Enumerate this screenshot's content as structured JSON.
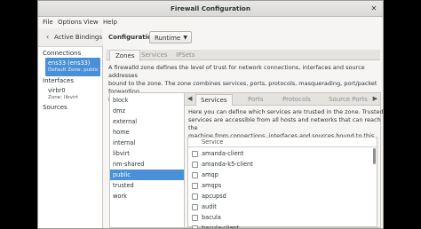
{
  "window": {
    "title": "Firewall Configuration"
  },
  "menubar": [
    "File",
    "Options",
    "View",
    "Help"
  ],
  "bindings": {
    "label": "Active Bindings"
  },
  "configuration": {
    "label": "Configuration:",
    "value": "Runtime"
  },
  "left_panel": {
    "connections_header": "Connections",
    "connection": {
      "name": "ens33 (ens33)",
      "zone": "Default Zone: public"
    },
    "interfaces_header": "Interfaces",
    "interface": {
      "name": "virbr0",
      "zone": "Zone: libvirt"
    },
    "sources_header": "Sources"
  },
  "tabs": [
    {
      "label": "Zones",
      "active": true
    },
    {
      "label": "Services",
      "active": false
    },
    {
      "label": "IPSets",
      "active": false
    }
  ],
  "zones_description": "A firewalld zone defines the level of trust for network connections, interfaces and source addresses\nbound to the zone. The zone combines services, ports, protocols, masquerading, port/packet forwarding,\nicmp filters and rich rules. The zone can be bound to interfaces and source addresses.",
  "zones": [
    "block",
    "dmz",
    "external",
    "home",
    "internal",
    "libvirt",
    "nm-shared",
    "public",
    "trusted",
    "work"
  ],
  "selected_zone": "public",
  "zone_tabs": [
    {
      "label": "Services",
      "active": true
    },
    {
      "label": "Ports",
      "active": false
    },
    {
      "label": "Protocols",
      "active": false
    },
    {
      "label": "Source Ports",
      "active": false
    }
  ],
  "services_description": "Here you can define which services are trusted in the zone. Trusted\nservices are accessible from all hosts and networks that can reach the\nmachine from connections, interfaces and sources bound to this zone.",
  "services_table": {
    "header": "Service",
    "rows": [
      "amanda-client",
      "amanda-k5-client",
      "amqp",
      "amqps",
      "apcupsd",
      "audit",
      "bacula",
      "bacula-client"
    ]
  }
}
